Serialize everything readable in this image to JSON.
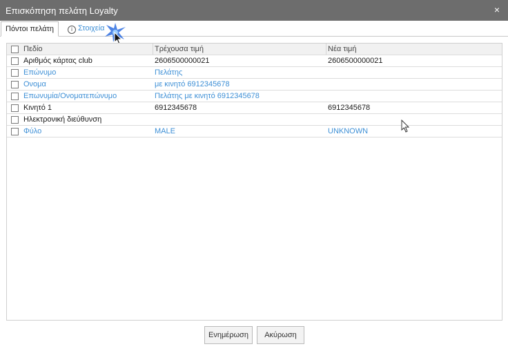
{
  "window": {
    "title": "Επισκόπηση πελάτη Loyalty",
    "close_glyph": "×"
  },
  "tabs": [
    {
      "label": "Πόντοι πελάτη"
    },
    {
      "label": "Στοιχεία",
      "icon": "info-icon"
    }
  ],
  "table": {
    "headers": [
      "Πεδίο",
      "Τρέχουσα τιμή",
      "Νέα τιμή"
    ],
    "rows": [
      {
        "field": "Αριθμός κάρτας club",
        "current": "2606500000021",
        "new": "2606500000021",
        "highlight": false
      },
      {
        "field": "Επώνυμο",
        "current": "Πελάτης",
        "new": "",
        "highlight": true
      },
      {
        "field": "Ονομα",
        "current": "με κινητό 6912345678",
        "new": "",
        "highlight": true
      },
      {
        "field": "Επωνυμία/Ονοματεπώνυμο",
        "current": "Πελάτης με κινητό 6912345678",
        "new": "",
        "highlight": true
      },
      {
        "field": "Κινητό 1",
        "current": "6912345678",
        "new": "6912345678",
        "highlight": false
      },
      {
        "field": "Ηλεκτρονική διεύθυνση",
        "current": "",
        "new": "",
        "highlight": false
      },
      {
        "field": "Φύλο",
        "current": "MALE",
        "new": "UNKNOWN",
        "highlight": true
      }
    ]
  },
  "buttons": {
    "update": "Ενημέρωση",
    "cancel": "Ακύρωση"
  },
  "colors": {
    "titlebar": "#6d6d6d",
    "link_blue": "#3d8fd6"
  }
}
